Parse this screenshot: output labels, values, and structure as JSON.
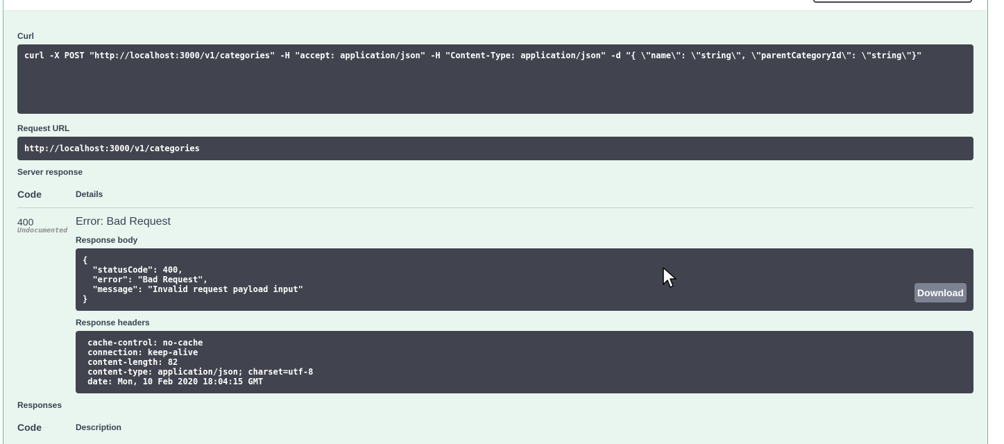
{
  "curl": {
    "label": "Curl",
    "command": "curl -X POST \"http://localhost:3000/v1/categories\" -H \"accept: application/json\" -H \"Content-Type: application/json\" -d \"{ \\\"name\\\": \\\"string\\\", \\\"parentCategoryId\\\": \\\"string\\\"}\""
  },
  "request_url": {
    "label": "Request URL",
    "value": "http://localhost:3000/v1/categories"
  },
  "server_response": {
    "label": "Server response",
    "col_code": "Code",
    "col_details": "Details",
    "status_code": "400",
    "status_note": "Undocumented",
    "title": "Error: Bad Request",
    "body_label": "Response body",
    "body": "{\n  \"statusCode\": 400,\n  \"error\": \"Bad Request\",\n  \"message\": \"Invalid request payload input\"\n}",
    "download_label": "Download",
    "headers_label": "Response headers",
    "headers": " cache-control: no-cache \n connection: keep-alive \n content-length: 82 \n content-type: application/json; charset=utf-8 \n date: Mon, 10 Feb 2020 18:04:15 GMT "
  },
  "responses": {
    "label": "Responses",
    "col_code": "Code",
    "col_description": "Description"
  },
  "colors": {
    "panel_bg": "#e8f6ef",
    "panel_border": "#49cc90",
    "code_bg": "#41444e",
    "download_bg": "#7d8293"
  },
  "icons": {
    "cursor": "mouse-pointer-icon"
  }
}
